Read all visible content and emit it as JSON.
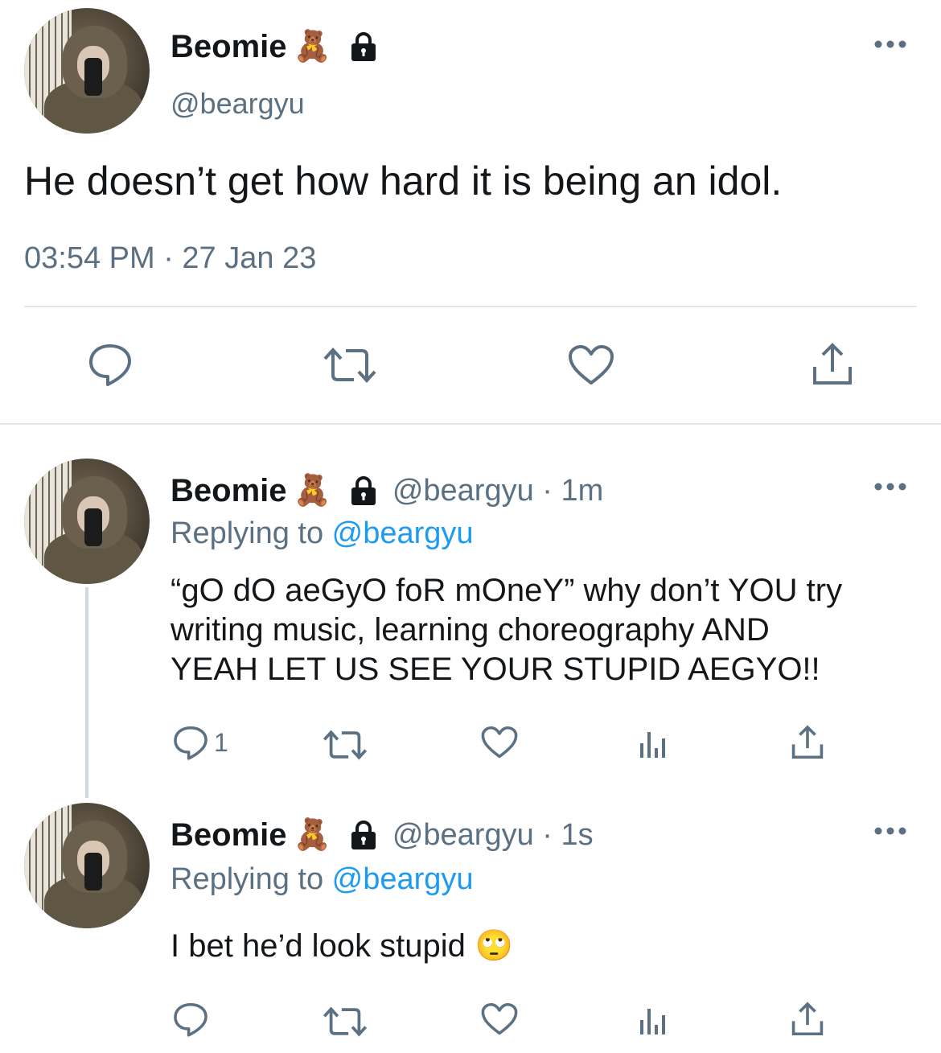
{
  "main_tweet": {
    "display_name": "Beomie",
    "name_emoji": "🧸",
    "handle": "@beargyu",
    "text": "He doesn’t get how hard it is being an idol.",
    "timestamp": "03:54 PM · 27 Jan 23"
  },
  "replies": [
    {
      "display_name": "Beomie",
      "name_emoji": "🧸",
      "handle_time": "@beargyu · 1m",
      "replying_prefix": "Replying to ",
      "replying_handle": "@beargyu",
      "text_lines": [
        "“gO dO aeGyO foR mOneY” why don’t YOU try",
        "writing music, learning choreography AND",
        "YEAH LET US SEE YOUR STUPID AEGYO!!"
      ],
      "reply_count": "1"
    },
    {
      "display_name": "Beomie",
      "name_emoji": "🧸",
      "handle_time": "@beargyu · 1s",
      "replying_prefix": "Replying to ",
      "replying_handle": "@beargyu",
      "text": "I bet he’d look stupid",
      "text_emoji": "🙄"
    }
  ],
  "colors": {
    "text": "#14171a",
    "secondary": "#5b7083",
    "link": "#1d9bf0",
    "divider": "#e1e8ed"
  },
  "icons": [
    "lock-icon",
    "more-icon",
    "reply-icon",
    "retweet-icon",
    "like-icon",
    "analytics-icon",
    "share-icon"
  ]
}
